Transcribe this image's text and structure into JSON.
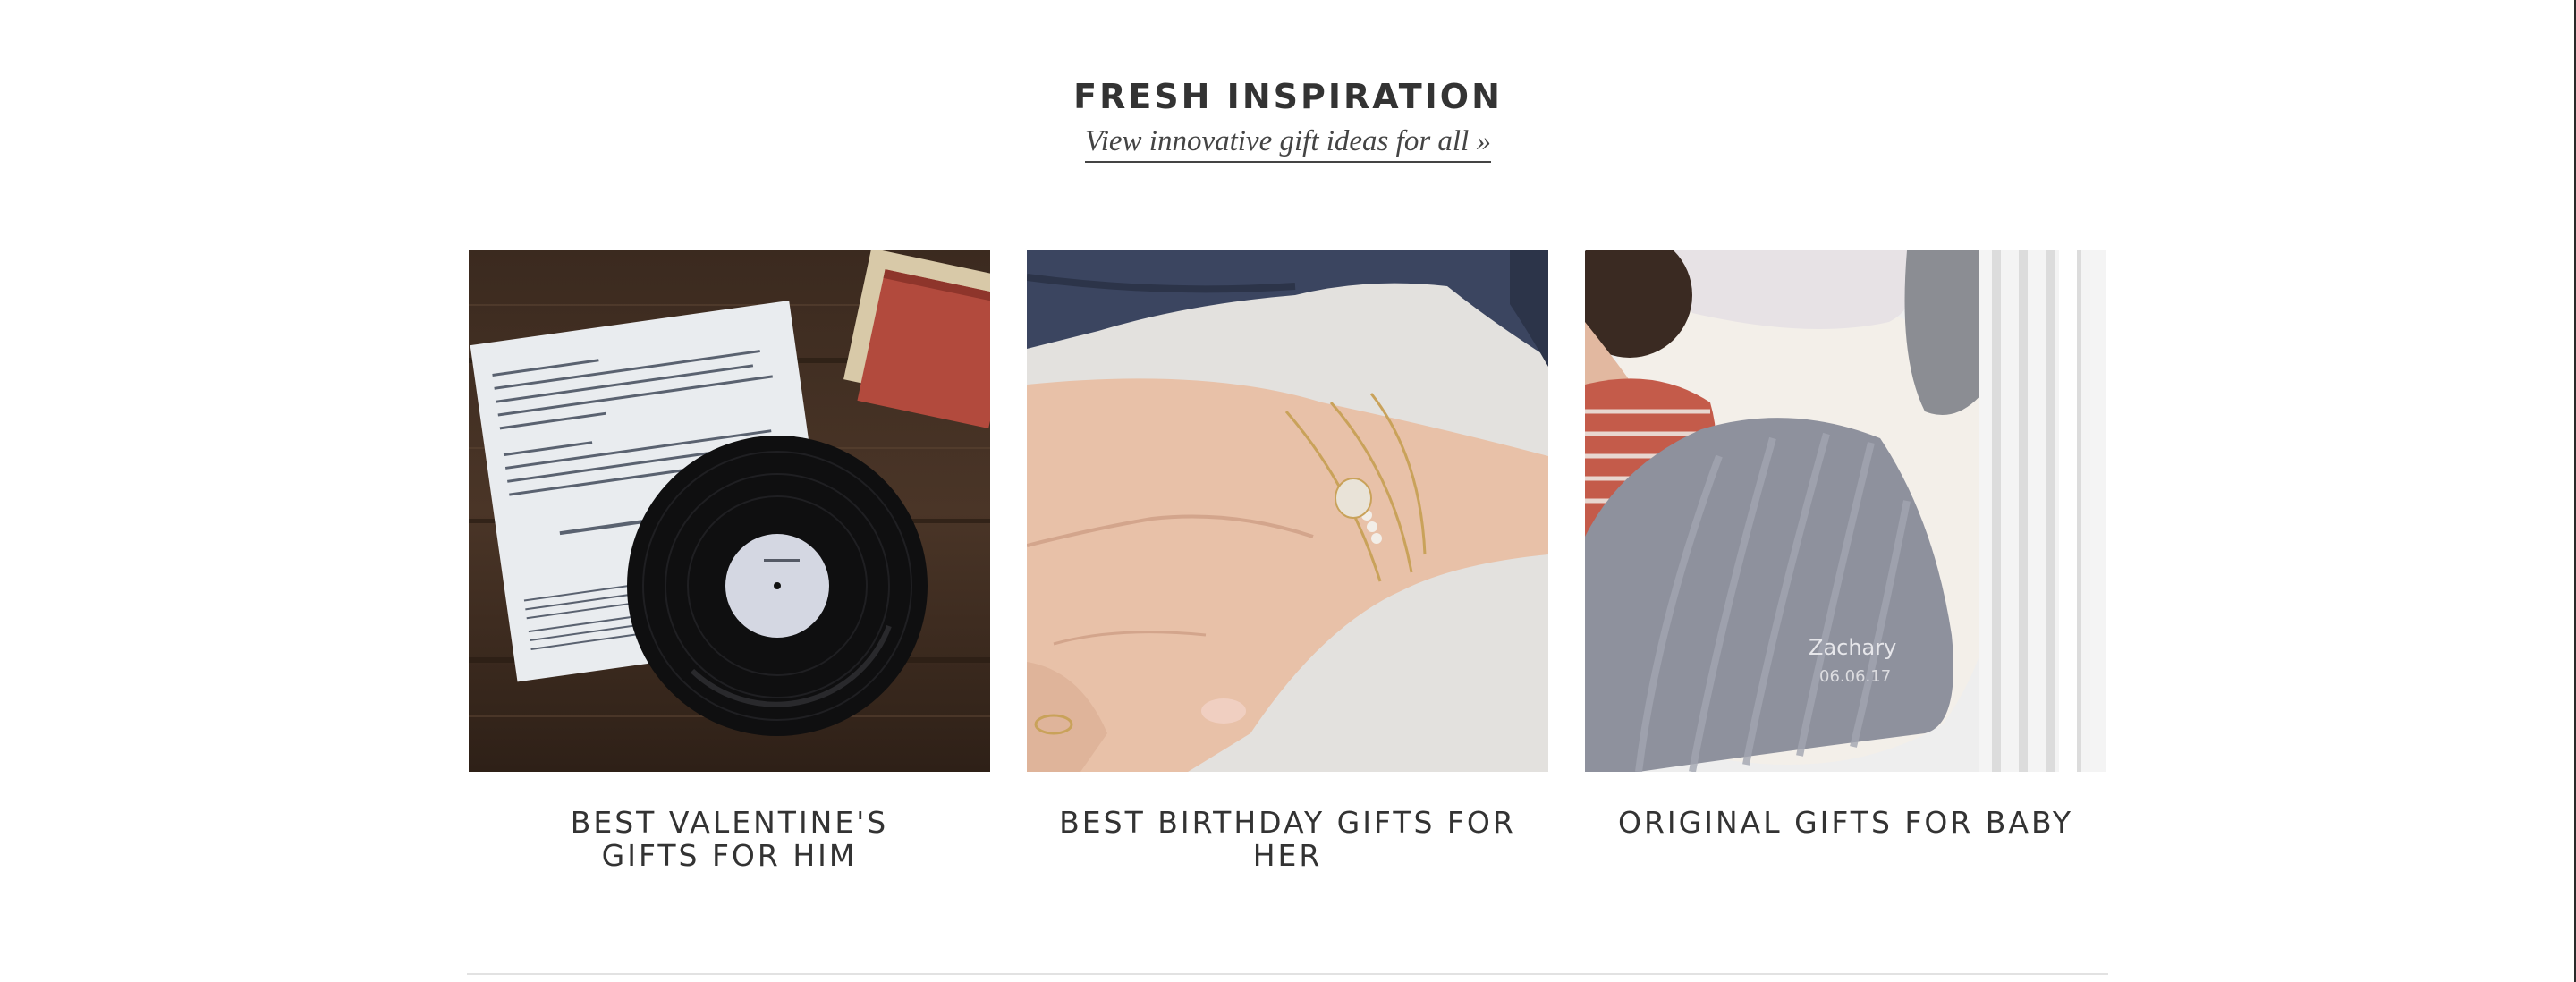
{
  "section": {
    "title": "FRESH INSPIRATION",
    "link_label": "View innovative gift ideas for all »"
  },
  "cards": [
    {
      "title": "BEST VALENTINE'S\nGIFTS FOR HIM",
      "image": "vinyl-record-and-typed-letter-photo"
    },
    {
      "title": "BEST BIRTHDAY GIFTS FOR HER",
      "image": "gold-bracelets-on-wrist-photo"
    },
    {
      "title": "ORIGINAL GIFTS FOR BABY",
      "image": "baby-with-knitted-blanket-photo"
    }
  ],
  "photo_text": {
    "blanket_name": "Zachary",
    "blanket_date": "06.06.17"
  },
  "colors": {
    "text": "#333333",
    "divider": "#e2e2e2",
    "background": "#ffffff"
  }
}
